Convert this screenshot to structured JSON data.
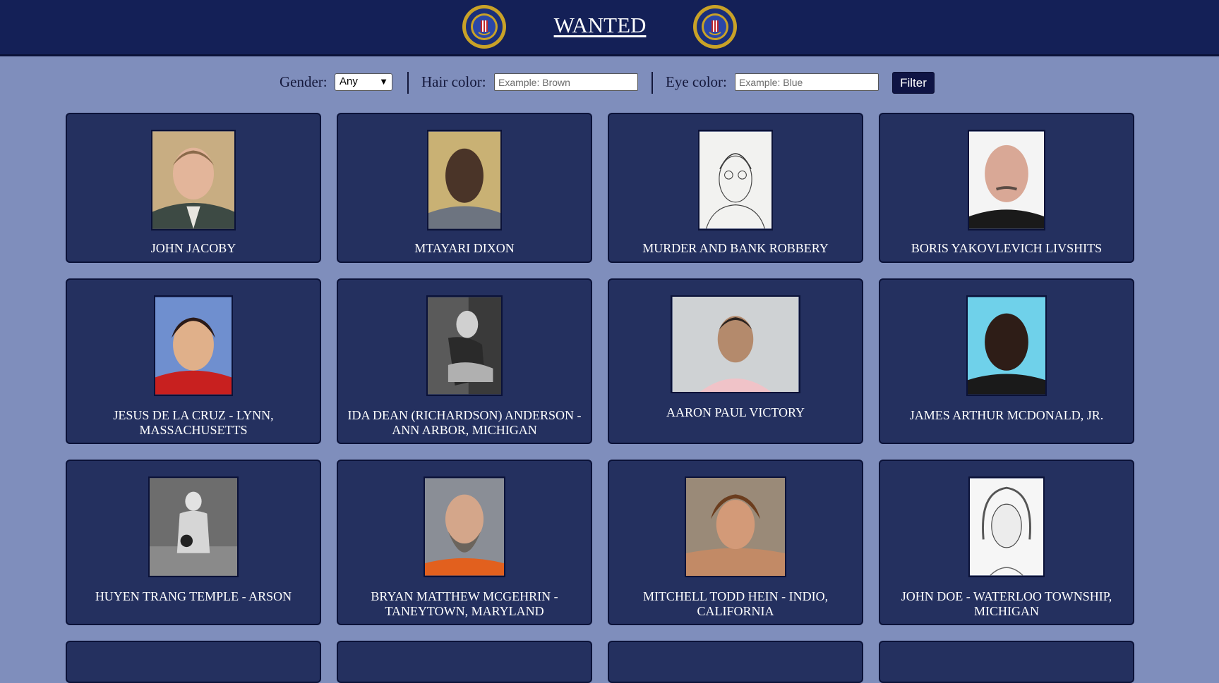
{
  "header": {
    "title": "WANTED"
  },
  "filters": {
    "gender_label": "Gender:",
    "gender_value": "Any",
    "hair_label": "Hair color:",
    "hair_placeholder": "Example: Brown",
    "eye_label": "Eye color:",
    "eye_placeholder": "Example: Blue",
    "filter_button": "Filter"
  },
  "cards": [
    {
      "name": "JOHN JACOBY",
      "photo": "portrait-photo"
    },
    {
      "name": "MTAYARI DIXON",
      "photo": "portrait-photo"
    },
    {
      "name": "MURDER AND BANK ROBBERY",
      "photo": "sketch"
    },
    {
      "name": "BORIS YAKOVLEVICH LIVSHITS",
      "photo": "portrait-photo"
    },
    {
      "name": "JESUS DE LA CRUZ - LYNN, MASSACHUSETTS",
      "photo": "portrait-photo"
    },
    {
      "name": "IDA DEAN (RICHARDSON) ANDERSON - ANN ARBOR, MICHIGAN",
      "photo": "bw-photo"
    },
    {
      "name": "AARON PAUL VICTORY",
      "photo": "portrait-photo"
    },
    {
      "name": "JAMES ARTHUR MCDONALD, JR.",
      "photo": "portrait-photo"
    },
    {
      "name": "HUYEN TRANG TEMPLE - ARSON",
      "photo": "surveillance-photo"
    },
    {
      "name": "BRYAN MATTHEW MCGEHRIN - TANEYTOWN, MARYLAND",
      "photo": "portrait-photo"
    },
    {
      "name": "MITCHELL TODD HEIN - INDIO, CALIFORNIA",
      "photo": "portrait-photo"
    },
    {
      "name": "JOHN DOE - WATERLOO TOWNSHIP, MICHIGAN",
      "photo": "sketch"
    }
  ],
  "colors": {
    "page_bg": "#7f8ebc",
    "header_bg": "#142057",
    "card_bg": "#24305f",
    "button_bg": "#0f1444"
  }
}
